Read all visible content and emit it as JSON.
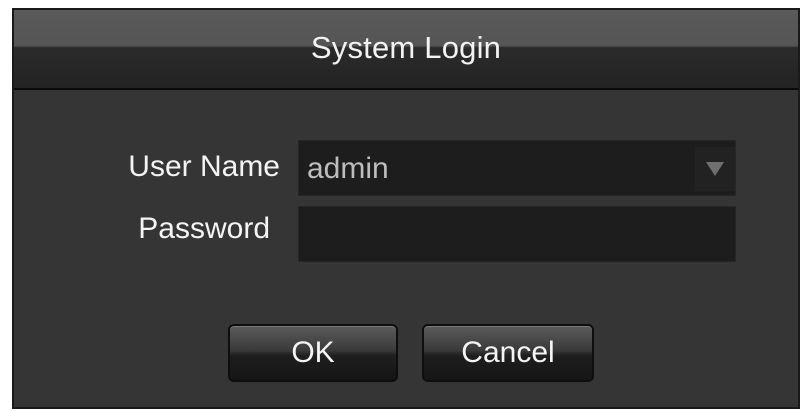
{
  "dialog": {
    "title": "System Login"
  },
  "form": {
    "user_name_label": "User Name",
    "user_name_value": "admin",
    "password_label": "Password",
    "password_value": ""
  },
  "buttons": {
    "ok_label": "OK",
    "cancel_label": "Cancel"
  },
  "icons": {
    "dropdown": "chevron-down-icon"
  },
  "colors": {
    "dialog_bg": "#343434",
    "field_bg": "#1d1d1d",
    "text": "#f4f4f4",
    "value_text": "#bdbdbd"
  }
}
